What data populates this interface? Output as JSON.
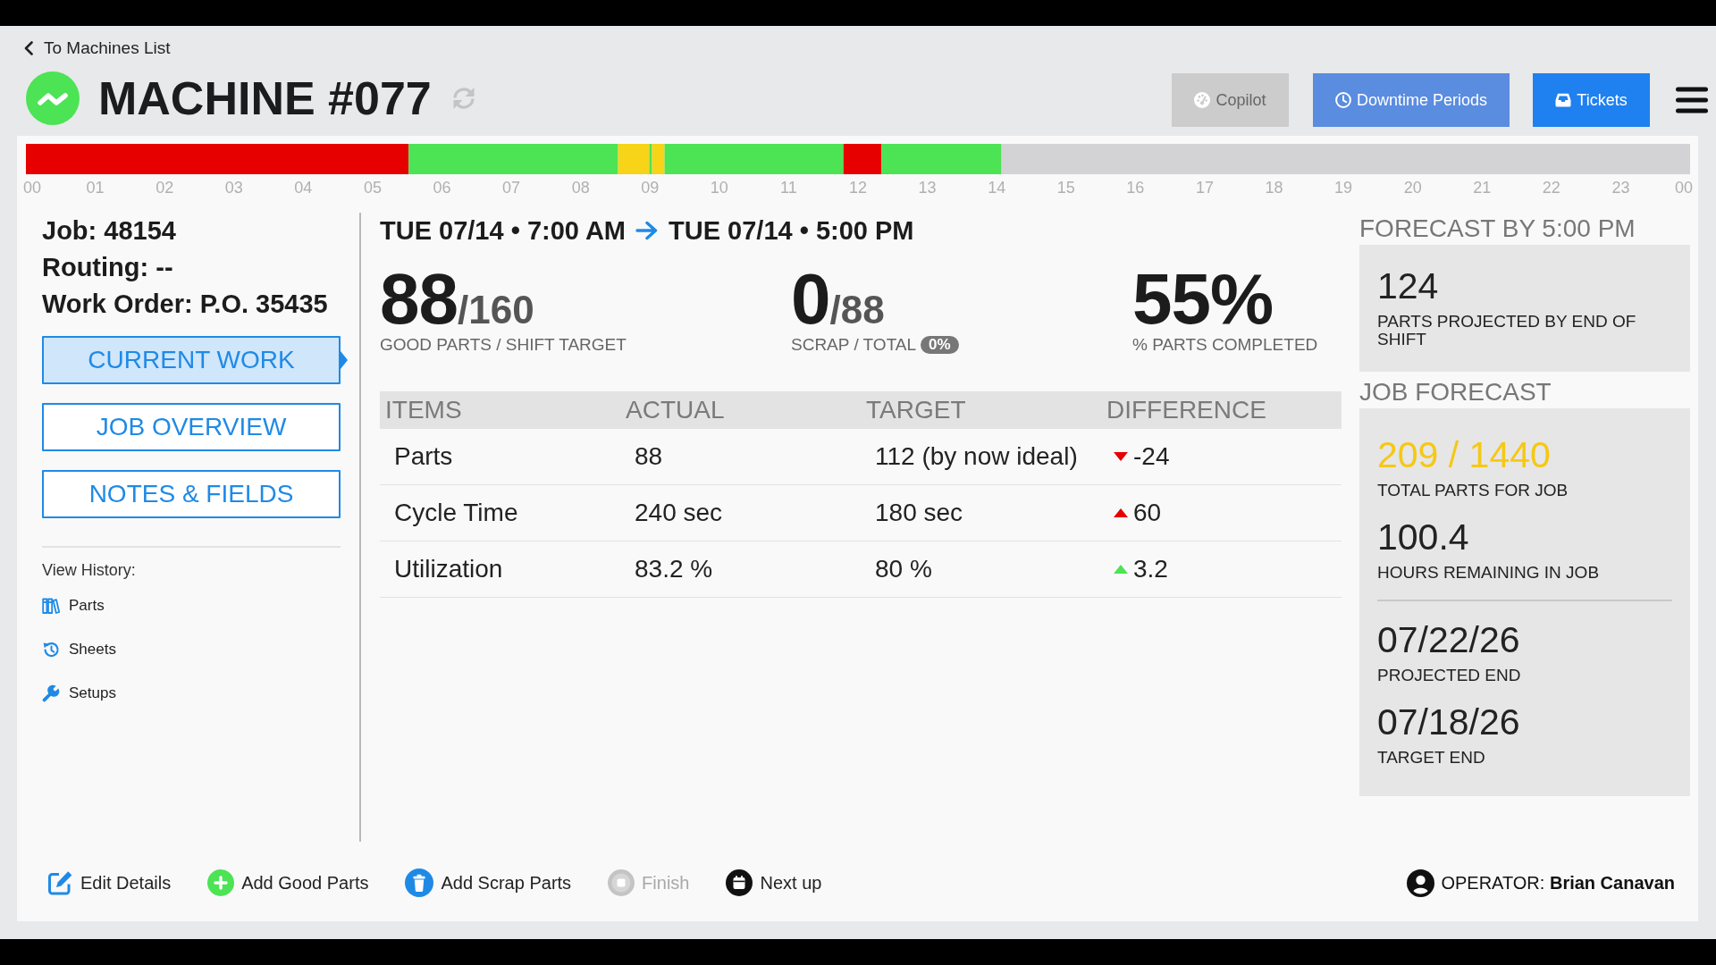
{
  "back_link": {
    "label": "To Machines List"
  },
  "machine": {
    "title": "MACHINE #077",
    "color": "#4ce355"
  },
  "header_buttons": [
    {
      "label": "Copilot",
      "kind": "gauge",
      "color": "#cccccc",
      "disabled": true
    },
    {
      "label": "Downtime Periods",
      "kind": "clock",
      "color": "#5a8ce0",
      "disabled": false
    },
    {
      "label": "Tickets",
      "kind": "tray",
      "color": "#1f80f0",
      "disabled": false
    }
  ],
  "timeline": {
    "chart_data": {
      "type": "bar",
      "orientation": "horizontal",
      "stacked": true,
      "xlim": [
        0,
        24
      ],
      "xticks": [
        {
          "value": 0,
          "label": "00"
        },
        {
          "value": 1,
          "label": "01"
        },
        {
          "value": 2,
          "label": "02"
        },
        {
          "value": 3,
          "label": "03"
        },
        {
          "value": 4,
          "label": "04"
        },
        {
          "value": 5,
          "label": "05"
        },
        {
          "value": 6,
          "label": "06"
        },
        {
          "value": 7,
          "label": "07"
        },
        {
          "value": 8,
          "label": "08"
        },
        {
          "value": 9,
          "label": "09"
        },
        {
          "value": 10,
          "label": "10"
        },
        {
          "value": 11,
          "label": "11"
        },
        {
          "value": 12,
          "label": "12"
        },
        {
          "value": 13,
          "label": "13"
        },
        {
          "value": 14,
          "label": "14"
        },
        {
          "value": 15,
          "label": "15"
        },
        {
          "value": 16,
          "label": "16"
        },
        {
          "value": 17,
          "label": "17"
        },
        {
          "value": 18,
          "label": "18"
        },
        {
          "value": 19,
          "label": "19"
        },
        {
          "value": 20,
          "label": "20"
        },
        {
          "value": 21,
          "label": "21"
        },
        {
          "value": 22,
          "label": "22"
        },
        {
          "value": 23,
          "label": "23"
        },
        {
          "value": 24,
          "label": "00"
        }
      ],
      "series": [
        {
          "color": "#e60000",
          "values": [
            5.52
          ]
        },
        {
          "color": "#4ce355",
          "values": [
            3.02
          ]
        },
        {
          "color": "#f7d417",
          "values": [
            0.45
          ]
        },
        {
          "color": "#4ce355",
          "values": [
            0.04
          ]
        },
        {
          "color": "#f7d417",
          "values": [
            0.18
          ]
        },
        {
          "color": "#4ce355",
          "values": [
            2.58
          ]
        },
        {
          "color": "#e60000",
          "values": [
            0.55
          ]
        },
        {
          "color": "#4ce355",
          "values": [
            1.73
          ]
        }
      ]
    }
  },
  "job_info": [
    "Job: 48154",
    "Routing: --",
    "Work Order: P.O. 35435"
  ],
  "nav_buttons": [
    {
      "label": "CURRENT WORK",
      "selected": true
    },
    {
      "label": "JOB OVERVIEW",
      "selected": false
    },
    {
      "label": "NOTES & FIELDS",
      "selected": false
    }
  ],
  "view_history": {
    "title": "View History:",
    "links": [
      {
        "label": "Parts",
        "kind": "books"
      },
      {
        "label": "Sheets",
        "kind": "history"
      },
      {
        "label": "Setups",
        "kind": "wrench"
      }
    ]
  },
  "shift": {
    "start": "TUE 07/14 • 7:00 AM",
    "end": "TUE 07/14 • 5:00 PM"
  },
  "metrics": [
    {
      "value": "88",
      "total": "/160",
      "label": "GOOD PARTS / SHIFT TARGET"
    },
    {
      "value": "0",
      "total": "/88",
      "label": "SCRAP / TOTAL",
      "badge": "0%"
    },
    {
      "value": "55%",
      "label": "% PARTS COMPLETED"
    }
  ],
  "table": {
    "columns": [
      "ITEMS",
      "ACTUAL",
      "TARGET",
      "DIFFERENCE"
    ],
    "rows": [
      {
        "item": "Parts",
        "actual": "88",
        "target": "112 (by now ideal)",
        "difference": {
          "value": "-24",
          "kind": "down",
          "color": "#e60000"
        }
      },
      {
        "item": "Cycle Time",
        "actual": "240 sec",
        "target": "180 sec",
        "difference": {
          "value": "60",
          "kind": "up",
          "color": "#e60000"
        }
      },
      {
        "item": "Utilization",
        "actual": "83.2 %",
        "target": "80 %",
        "difference": {
          "value": "3.2",
          "kind": "up",
          "color": "#4ce355"
        }
      }
    ]
  },
  "forecast": {
    "title": "FORECAST BY 5:00 PM",
    "stats": [
      {
        "value": "124",
        "label": "PARTS PROJECTED BY END OF SHIFT"
      }
    ]
  },
  "job_forecast": {
    "title": "JOB FORECAST",
    "groups": [
      {
        "stats": [
          {
            "value": "209 / 1440",
            "label": "TOTAL PARTS FOR JOB",
            "color": "#f5c814"
          },
          {
            "value": "100.4",
            "label": "HOURS REMAINING IN JOB",
            "color": "#222222"
          }
        ]
      },
      {
        "stats": [
          {
            "value": "07/22/26",
            "label": "PROJECTED END",
            "color": "#222222"
          },
          {
            "value": "07/18/26",
            "label": "TARGET END",
            "color": "#222222"
          }
        ]
      }
    ]
  },
  "actions": [
    {
      "label": "Edit Details",
      "kind": "edit",
      "disabled": false
    },
    {
      "label": "Add Good Parts",
      "kind": "plus",
      "disabled": false
    },
    {
      "label": "Add Scrap Parts",
      "kind": "trash",
      "disabled": false
    },
    {
      "label": "Finish",
      "kind": "stop",
      "disabled": true
    },
    {
      "label": "Next up",
      "kind": "calendar",
      "disabled": false
    }
  ],
  "operator": {
    "text": "OPERATOR: **Brian Canavan**"
  }
}
